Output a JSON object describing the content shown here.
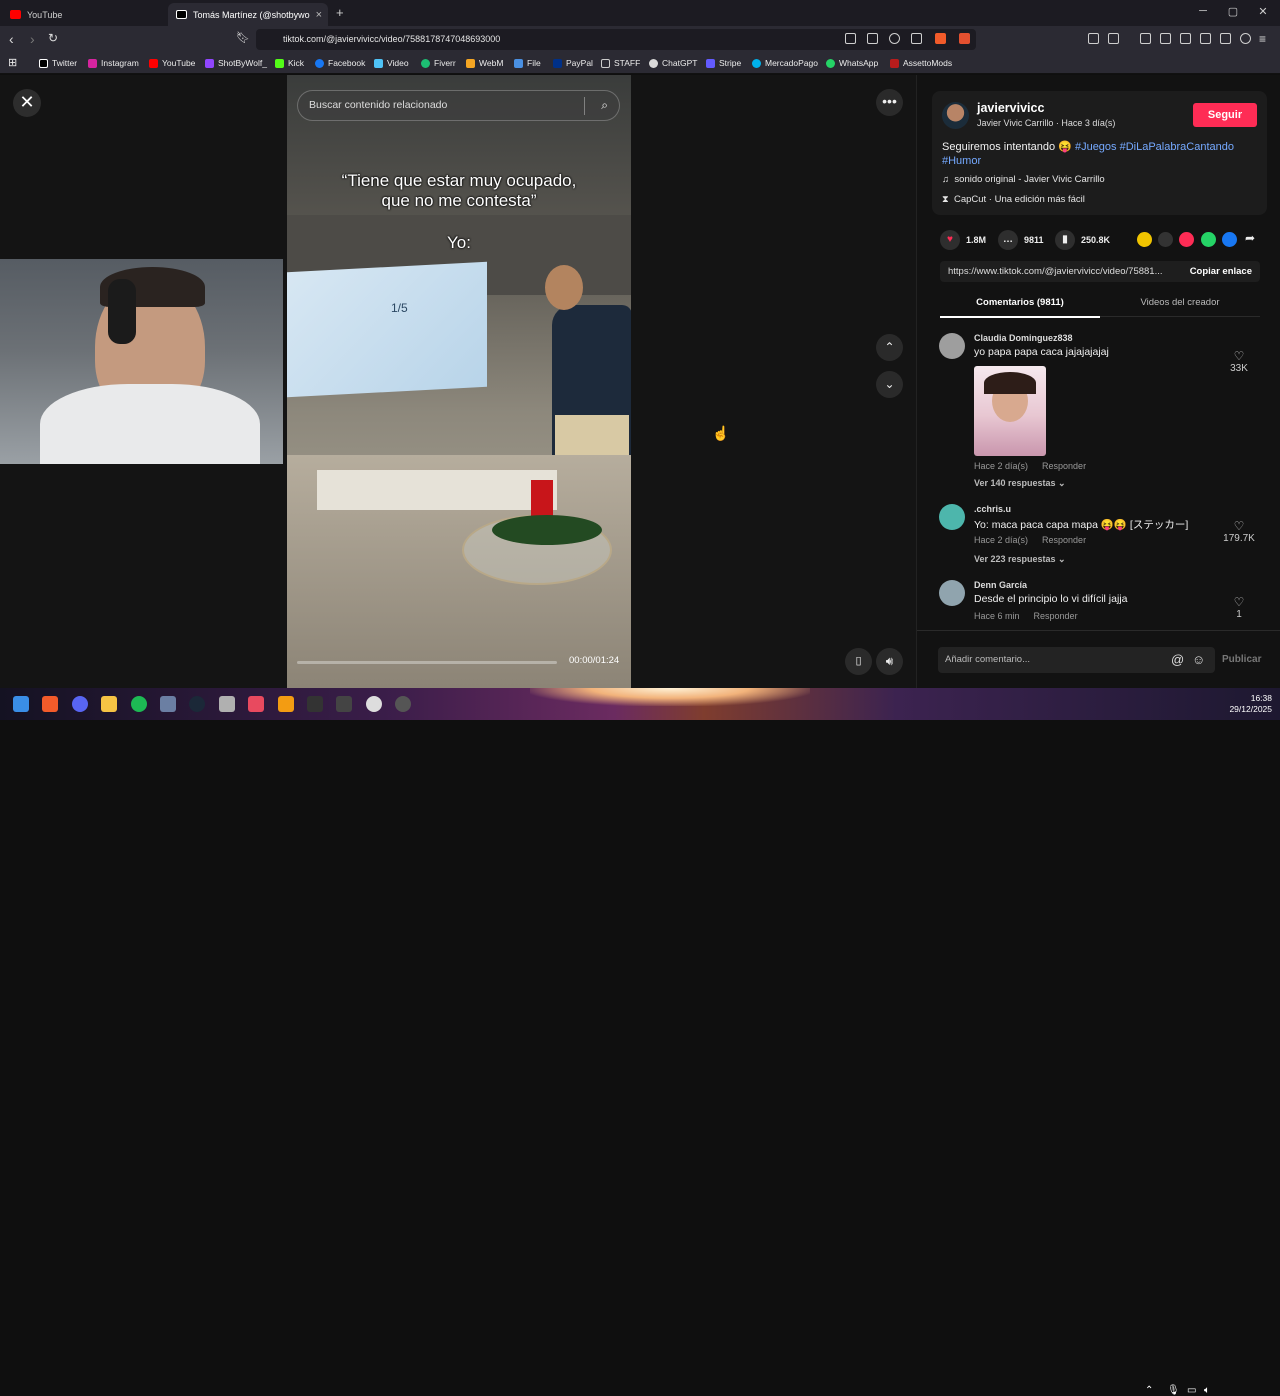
{
  "browser": {
    "tabs": [
      {
        "label": "YouTube",
        "active": false
      },
      {
        "label": "Tomás Martínez (@shotbywo",
        "active": true
      }
    ],
    "new_tab": "+",
    "window_controls": {
      "minimize": "─",
      "maximize": "▢",
      "close": "✕"
    },
    "url": "tiktok.com/@javiervivicc/video/7588178747048693000",
    "bookmarks": [
      {
        "label": "Twitter",
        "color": "#000000"
      },
      {
        "label": "Instagram",
        "color": "#d6249f"
      },
      {
        "label": "YouTube",
        "color": "#ff0000"
      },
      {
        "label": "ShotByWolf_",
        "color": "#9146ff"
      },
      {
        "label": "Kick",
        "color": "#53fc18"
      },
      {
        "label": "Facebook",
        "color": "#1877f2"
      },
      {
        "label": "Video",
        "color": "#4fc3f7"
      },
      {
        "label": "Fiverr",
        "color": "#1dbf73"
      },
      {
        "label": "WebM",
        "color": "#f5a623"
      },
      {
        "label": "File",
        "color": "#4a90e2"
      },
      {
        "label": "PayPal",
        "color": "#003087"
      },
      {
        "label": "STAFF",
        "color": "#cccccc"
      },
      {
        "label": "ChatGPT",
        "color": "#d9d9d9"
      },
      {
        "label": "Stripe",
        "color": "#635bff"
      },
      {
        "label": "MercadoPago",
        "color": "#00b1ea"
      },
      {
        "label": "WhatsApp",
        "color": "#25d366"
      },
      {
        "label": "AssettoMods",
        "color": "#b71c1c"
      }
    ]
  },
  "video": {
    "search_placeholder": "Buscar contenido relacionado",
    "caption_line1": "“Tiene que estar muy ocupado,",
    "caption_line2": "que no me contesta”",
    "caption_yo": "Yo:",
    "tv_text": "1/5",
    "time": "00:00/01:24",
    "progress": 0.0
  },
  "post": {
    "username": "javiervivicc",
    "subtitle": "Javier Vivic Carrillo · Hace 3 día(s)",
    "follow_label": "Seguir",
    "description_text": "Seguiremos intentando 😝",
    "tags": [
      "#Juegos",
      "#DiLaPalabraCantando",
      "#Humor"
    ],
    "sound": "sonido original - Javier Vivic Carrillo",
    "capcut": "CapCut · Una edición más fácil",
    "likes": "1.8M",
    "comments": "9811",
    "saves": "250.8K",
    "link": "https://www.tiktok.com/@javiervivicc/video/75881...",
    "copy_label": "Copiar enlace",
    "tab_comments": "Comentarios (9811)",
    "tab_creator": "Videos del creador"
  },
  "comments": [
    {
      "user": "Claudia Dominguez838",
      "text": "yo papa papa caca jajajajajaj",
      "time": "Hace 2 día(s)",
      "reply": "Responder",
      "replies": "Ver 140 respuestas ⌄",
      "likes": "33K",
      "avatar_color": "#9e9e9e"
    },
    {
      "user": ".cchris.u",
      "text": "Yo: maca paca capa mapa 😝😝 [ステッカー]",
      "time": "Hace 2 día(s)",
      "reply": "Responder",
      "replies": "Ver 223 respuestas ⌄",
      "likes": "179.7K",
      "avatar_color": "#4db6ac"
    },
    {
      "user": "Denn García",
      "text": "Desde el principio lo vi difícil jajja",
      "time": "Hace 6 min",
      "reply": "Responder",
      "replies": "",
      "likes": "1",
      "avatar_color": "#90a4ae"
    }
  ],
  "composer": {
    "placeholder": "Añadir comentario...",
    "publish": "Publicar"
  },
  "taskbar": {
    "time": "16:38",
    "date": "29/12/2025"
  },
  "colors": {
    "accent": "#fe2c55",
    "tag": "#75a9ff"
  }
}
